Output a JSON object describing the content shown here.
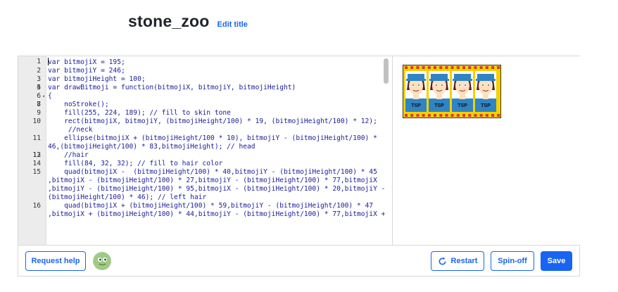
{
  "header": {
    "title": "stone_zoo",
    "edit_title": "Edit title"
  },
  "editor": {
    "lines": [
      {
        "n": "1",
        "t": "var bitmojiX = 195;"
      },
      {
        "n": "2",
        "t": "var bitmojiY = 246;"
      },
      {
        "n": "3",
        "t": "var bitmojiHeight = 100;"
      },
      {
        "n": "4",
        "t": ""
      },
      {
        "n": "5",
        "t": "var drawBitmoji = function(bitmojiX, bitmojiY, bitmojiHeight)"
      },
      {
        "n": "6",
        "t": "{",
        "fold": "▾"
      },
      {
        "n": "7",
        "t": ""
      },
      {
        "n": "8",
        "t": "    noStroke();"
      },
      {
        "n": "9",
        "t": "    fill(255, 224, 189); // fill to skin tone"
      },
      {
        "n": "10",
        "t": "    rect(bitmojiX, bitmojiY, (bitmojiHeight/100) * 19, (bitmojiHeight/100) * 12);"
      },
      {
        "n": "",
        "t": "     //neck"
      },
      {
        "n": "11",
        "t": "    ellipse(bitmojiX + (bitmojiHeight/100 * 10), bitmojiY - (bitmojiHeight/100) *"
      },
      {
        "n": "",
        "t": "46,(bitmojiHeight/100) * 83,bitmojiHeight); // head"
      },
      {
        "n": "12",
        "t": ""
      },
      {
        "n": "13",
        "t": "    //hair"
      },
      {
        "n": "14",
        "t": "    fill(84, 32, 32); // fill to hair color"
      },
      {
        "n": "15",
        "t": "    quad(bitmojiX -  (bitmojiHeight/100) * 40,bitmojiY - (bitmojiHeight/100) * 45"
      },
      {
        "n": "",
        "t": ",bitmojiX - (bitmojiHeight/100) * 27,bitmojiY - (bitmojiHeight/100) * 77,bitmojiX"
      },
      {
        "n": "",
        "t": ",bitmojiY - (bitmojiHeight/100) * 95,bitmojiX - (bitmojiHeight/100) * 20,bitmojiY -"
      },
      {
        "n": "",
        "t": "(bitmojiHeight/100) * 46); // left hair"
      },
      {
        "n": "16",
        "t": "    quad(bitmojiX + (bitmojiHeight/100) * 59,bitmojiY - (bitmojiHeight/100) * 47"
      },
      {
        "n": "",
        "t": ",bitmojiX + (bitmojiHeight/100) * 44,bitmojiY - (bitmojiHeight/100) * 77,bitmojiX +"
      }
    ]
  },
  "canvas": {
    "figure_label": "TSP"
  },
  "footer": {
    "request_help": "Request help",
    "restart": "Restart",
    "spinoff": "Spin-off",
    "save": "Save"
  },
  "colors": {
    "accent": "#1865f2",
    "skin": "#ffe0bd",
    "hair": "#542020",
    "hat": "#2f84c4",
    "strip": "#f5d000"
  }
}
